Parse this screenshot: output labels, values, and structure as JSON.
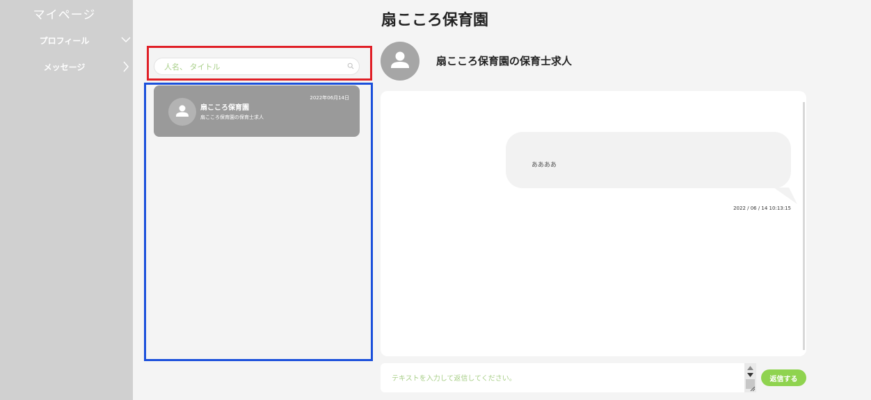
{
  "sidebar": {
    "title": "マイページ",
    "items": [
      {
        "label": "プロフィール",
        "icon": "chevron-down-icon"
      },
      {
        "label": "メッセージ",
        "icon": "chevron-right-icon"
      }
    ]
  },
  "page": {
    "title": "扇こころ保育園"
  },
  "search": {
    "placeholder": "人名、 タイトル",
    "value": ""
  },
  "conversations": [
    {
      "name": "扇こころ保育園",
      "subtitle": "扇こころ保育園の保育士求人",
      "date": "2022年06月14日",
      "icon": "user-icon"
    }
  ],
  "chat": {
    "title": "扇こころ保育園の保育士求人",
    "messages": [
      {
        "text": "ああああ",
        "timestamp": "2022 / 06 / 14 10:13:15"
      }
    ]
  },
  "reply": {
    "placeholder": "テキストを入力して返信してください。",
    "value": "",
    "send_label": "返信する"
  },
  "colors": {
    "sidebar_bg": "#d0d0d0",
    "accent_green": "#8fd34f",
    "placeholder_green": "#a8cf88",
    "highlight_red": "#e01f26",
    "highlight_blue": "#1a4fdb"
  }
}
